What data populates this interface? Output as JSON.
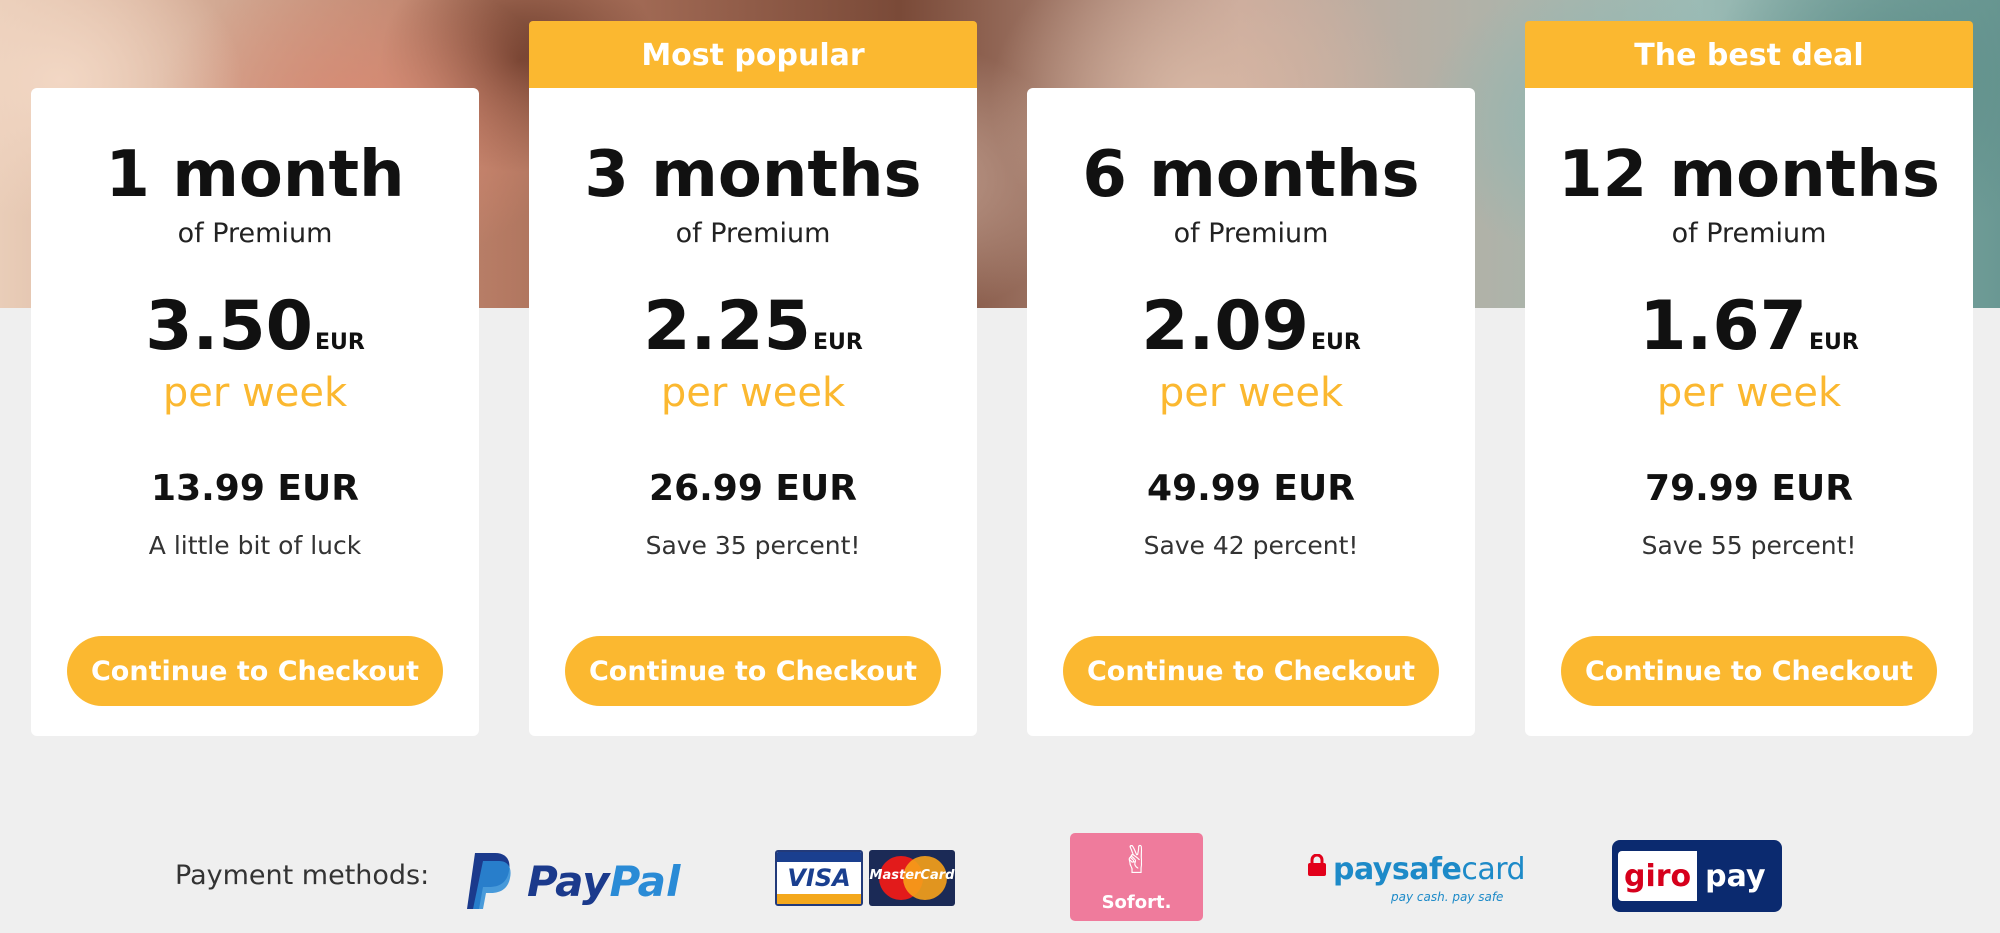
{
  "plans": [
    {
      "ribbon": "",
      "title": "1 month",
      "subtitle": "of Premium",
      "price": "3.50",
      "currency": "EUR",
      "period": "per week",
      "total": "13.99 EUR",
      "note": "A little bit of luck",
      "cta": "Continue to Checkout"
    },
    {
      "ribbon": "Most popular",
      "title": "3 months",
      "subtitle": "of Premium",
      "price": "2.25",
      "currency": "EUR",
      "period": "per week",
      "total": "26.99 EUR",
      "note": "Save 35 percent!",
      "cta": "Continue to Checkout"
    },
    {
      "ribbon": "",
      "title": "6 months",
      "subtitle": "of Premium",
      "price": "2.09",
      "currency": "EUR",
      "period": "per week",
      "total": "49.99 EUR",
      "note": "Save 42 percent!",
      "cta": "Continue to Checkout"
    },
    {
      "ribbon": "The best deal",
      "title": "12 months",
      "subtitle": "of Premium",
      "price": "1.67",
      "currency": "EUR",
      "period": "per week",
      "total": "79.99 EUR",
      "note": "Save 55 percent!",
      "cta": "Continue to Checkout"
    }
  ],
  "payments": {
    "label": "Payment methods:",
    "paypal": {
      "pay": "Pay",
      "pal": "Pal"
    },
    "visa": "VISA",
    "mastercard": "MasterCard",
    "sofort": "Sofort.",
    "paysafe": {
      "main": "paysafe",
      "card": "card",
      "tagline": "pay cash. pay safe"
    },
    "giropay": {
      "giro": "giro",
      "pay": "pay"
    }
  },
  "colors": {
    "accent": "#fbb830",
    "background": "#efefef",
    "card": "#ffffff"
  }
}
